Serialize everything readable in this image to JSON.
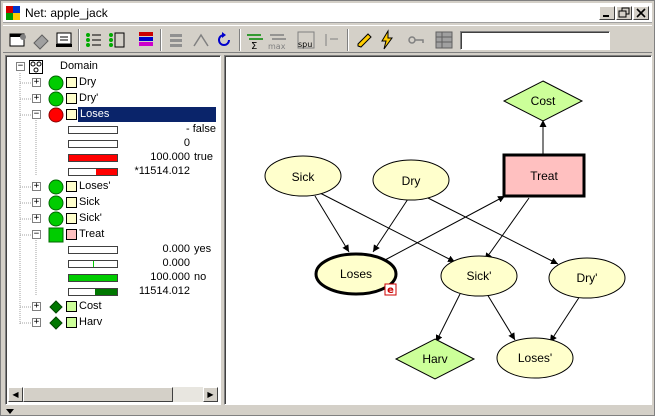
{
  "window": {
    "title": "Net: apple_jack"
  },
  "toolbar": {
    "tools": [
      "properties-icon",
      "eraser-icon",
      "notebook-icon",
      "list-order-icon",
      "node-list-icon",
      "node-table-icon",
      "palette-icon",
      "align-icon",
      "disconnect-icon",
      "undo-icon",
      "sum-propagate-icon",
      "max-propagate-icon",
      "spu-icon",
      "analysis-icon",
      "pencil-icon",
      "lightning-icon",
      "key-icon",
      "table-grid-icon"
    ],
    "spu_label": "spu",
    "sum_label": "Σ",
    "max_label": "max",
    "input_value": ""
  },
  "tree": {
    "root": "Domain",
    "nodes": [
      {
        "name": "Dry",
        "kind": "chance"
      },
      {
        "name": "Dry'",
        "kind": "chance"
      },
      {
        "name": "Loses",
        "kind": "chance-evidence",
        "expanded": true,
        "states": [
          {
            "value": "- false",
            "label": ""
          },
          {
            "value": "0",
            "label": ""
          },
          {
            "value": "100.000",
            "label": "true"
          },
          {
            "value": "*11514.012",
            "label": ""
          }
        ]
      },
      {
        "name": "Loses'",
        "kind": "chance"
      },
      {
        "name": "Sick",
        "kind": "chance"
      },
      {
        "name": "Sick'",
        "kind": "chance"
      },
      {
        "name": "Treat",
        "kind": "decision",
        "expanded": true,
        "states": [
          {
            "value": "0.000",
            "label": "yes"
          },
          {
            "value": "0.000",
            "label": ""
          },
          {
            "value": "100.000",
            "label": "no"
          },
          {
            "value": "11514.012",
            "label": ""
          }
        ]
      },
      {
        "name": "Cost",
        "kind": "utility"
      },
      {
        "name": "Harv",
        "kind": "utility"
      }
    ]
  },
  "graph": {
    "nodes": {
      "sick": "Sick",
      "dry": "Dry",
      "treat": "Treat",
      "cost": "Cost",
      "loses": "Loses",
      "sick2": "Sick'",
      "dry2": "Dry'",
      "harv": "Harv",
      "loses2": "Loses'"
    },
    "evidence_badge": "e"
  },
  "colors": {
    "chance_fill": "#ffffcc",
    "decision_fill": "#ffc0c0",
    "utility_fill": "#ccff99",
    "selection": "#0a246a",
    "green_node": "#00cc00",
    "red_node": "#ff0000"
  }
}
